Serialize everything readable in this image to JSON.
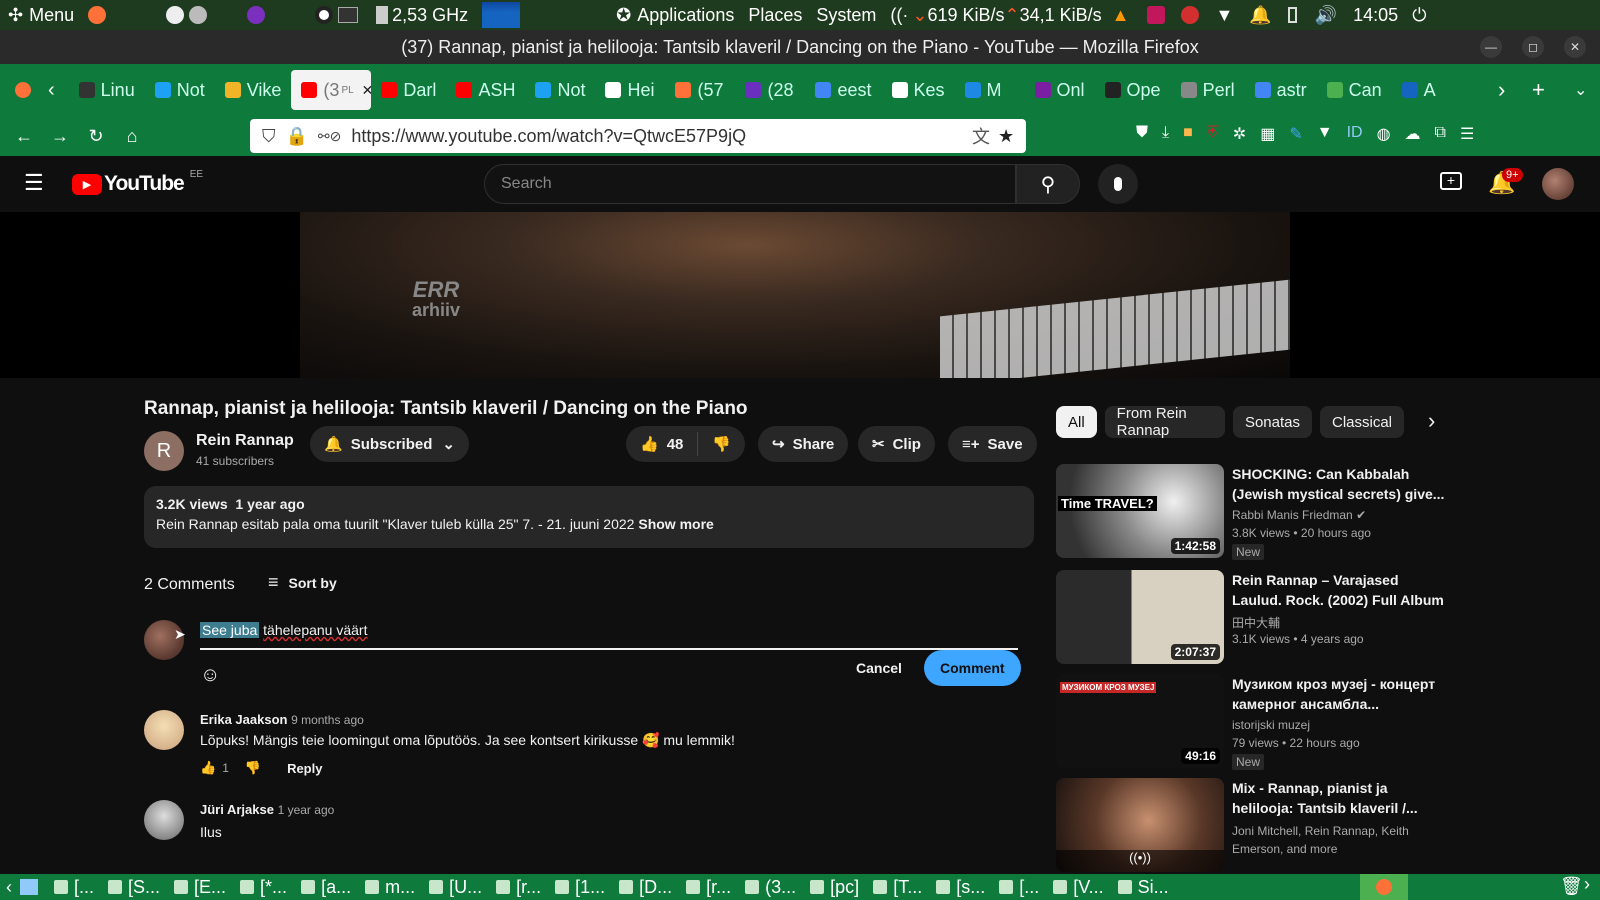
{
  "top_panel": {
    "menu": "Menu",
    "cpu_freq": "2,53 GHz",
    "applications": "Applications",
    "places": "Places",
    "system": "System",
    "net_down": "619 KiB/s",
    "net_up": "34,1 KiB/s",
    "clock": "14:05"
  },
  "window": {
    "title": "(37) Rannap, pianist ja helilooja: Tantsib klaveril / Dancing on the Piano - YouTube — Mozilla Firefox"
  },
  "tabs": [
    {
      "label": "Linu",
      "color": "#333333"
    },
    {
      "label": "Not",
      "color": "#1da1f2"
    },
    {
      "label": "Vike",
      "color": "#f0b429"
    },
    {
      "label": "(3",
      "sub": "PL",
      "color": "#ff0000",
      "active": true
    },
    {
      "label": "Darl",
      "color": "#ff0000"
    },
    {
      "label": "ASH",
      "color": "#ff0000"
    },
    {
      "label": "Not",
      "color": "#1da1f2"
    },
    {
      "label": "Hei",
      "color": "#ffffff"
    },
    {
      "label": "(57",
      "color": "#ff7139"
    },
    {
      "label": "(28",
      "color": "#6b2fbf"
    },
    {
      "label": "eest",
      "color": "#4285f4"
    },
    {
      "label": "Kes",
      "color": "#ffffff"
    },
    {
      "label": "M",
      "color": "#1e88e5"
    },
    {
      "label": "Onl",
      "color": "#7b1fa2"
    },
    {
      "label": "Ope",
      "color": "#222222"
    },
    {
      "label": "Perl",
      "color": "#888888"
    },
    {
      "label": "astr",
      "color": "#4285f4"
    },
    {
      "label": "Can",
      "color": "#4caf50"
    },
    {
      "label": "A",
      "color": "#1565c0"
    }
  ],
  "url": "https://www.youtube.com/watch?v=QtwcE57P9jQ",
  "youtube": {
    "logo_text": "YouTube",
    "region": "EE",
    "search_placeholder": "Search",
    "notifications": "9+",
    "player_watermark_1": "ERR",
    "player_watermark_2": "arhiiv",
    "video_title": "Rannap, pianist ja helilooja: Tantsib klaveril / Dancing on the Piano",
    "channel_initial": "R",
    "channel_name": "Rein Rannap",
    "subscribers": "41 subscribers",
    "subscribed_label": "Subscribed",
    "likes": "48",
    "share_label": "Share",
    "clip_label": "Clip",
    "save_label": "Save",
    "views": "3.2K views",
    "upload_age": "1 year ago",
    "description": "Rein Rannap esitab pala oma tuurilt \"Klaver tuleb külla 25\" 7. - 21. juuni 2022",
    "show_more": "Show more",
    "comments_count": "2 Comments",
    "sort_by": "Sort by",
    "comment_draft_selected": "See juba",
    "comment_draft_rest": "tähelepanu väärt",
    "cancel_label": "Cancel",
    "comment_label": "Comment",
    "comments": [
      {
        "author": "Erika Jaakson",
        "age": "9 months ago",
        "text": "Lõpuks! Mängis teie loomingut oma lõputöös.  Ja see kontsert kirikusse 🥰 mu lemmik!",
        "likes": "1",
        "reply": "Reply"
      },
      {
        "author": "Jüri Arjakse",
        "age": "1 year ago",
        "text": "Ilus"
      }
    ],
    "chips": [
      "All",
      "From Rein Rannap",
      "Sonatas",
      "Classical"
    ],
    "recommendations": [
      {
        "title": "SHOCKING: Can Kabbalah (Jewish mystical secrets) give...",
        "channel": "Rabbi Manis Friedman",
        "meta": "3.8K views  •  20 hours ago",
        "badge": "New",
        "duration": "1:42:58",
        "thumb_text": "Time TRAVEL?"
      },
      {
        "title": "Rein Rannap – Varajased Laulud. Rock. (2002) Full Album",
        "channel": "田中大輔",
        "meta": "3.1K views  •  4 years ago",
        "duration": "2:07:37"
      },
      {
        "title": "Музиком кроз музеј - концерт камерног ансамбла...",
        "channel": "istorijski muzej",
        "meta": "79 views  •  22 hours ago",
        "badge": "New",
        "duration": "49:16",
        "thumb_text": "МУЗИКОМ КРОЗ МУЗЕЈ"
      },
      {
        "title": "Mix - Rannap, pianist ja helilooja: Tantsib klaveril /...",
        "channel": "Joni Mitchell, Rein Rannap, Keith Emerson, and more"
      }
    ]
  },
  "taskbar": [
    "[...",
    "[S...",
    "[E...",
    "[*...",
    "[a...",
    "m...",
    "[U...",
    "[r...",
    "[1...",
    "[D...",
    "[r...",
    "(3...",
    "[pc]",
    "[T...",
    "[s...",
    "[...",
    "[V...",
    "Si..."
  ]
}
